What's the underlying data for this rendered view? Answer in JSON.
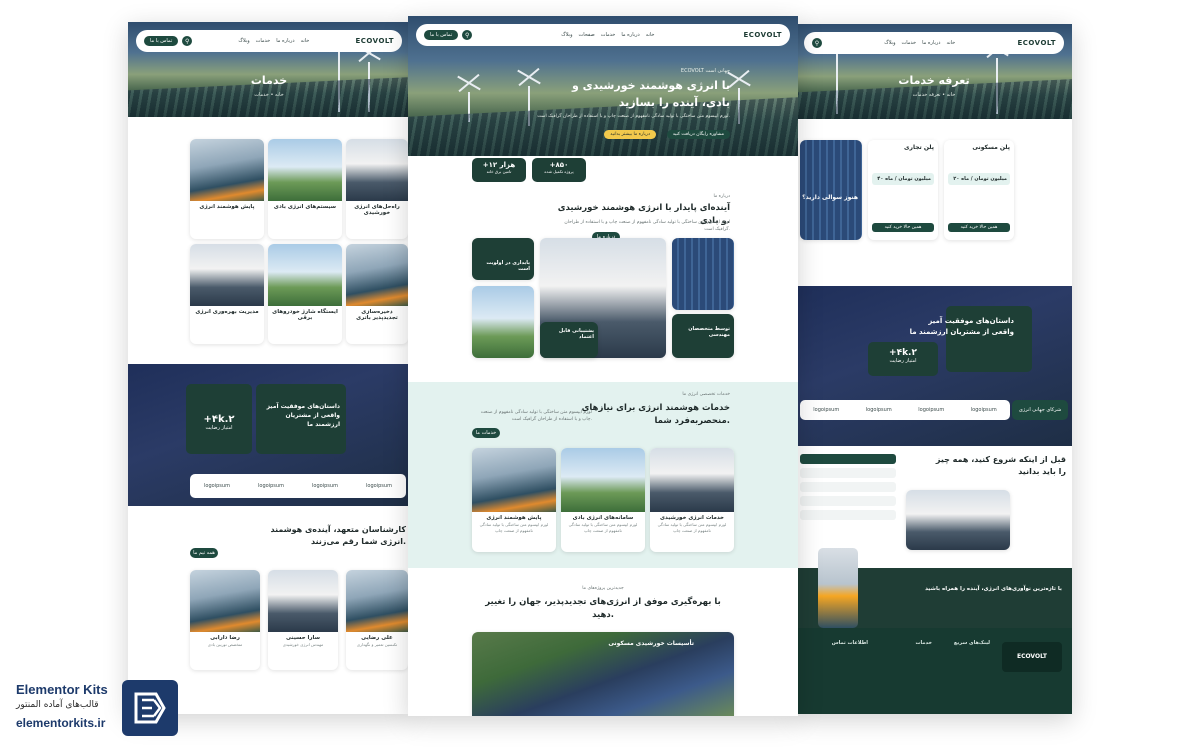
{
  "brand": {
    "name": "Elementor Kits",
    "subtitle": "قالب‌های آماده المنتور",
    "url": "elementorkits.ir",
    "logo_icon": "ek-monogram-icon",
    "color": "#1d3a6b"
  },
  "site": {
    "logo": "ECOVOLT",
    "accent": "#1e4a3f"
  },
  "left_page": {
    "nav_links": [
      "خانه",
      "درباره ما",
      "خدمات",
      "وبلاگ"
    ],
    "nav_cta": "تماس با ما",
    "hero_title": "خدمات",
    "breadcrumb": "خانه  •  خدمات",
    "services": [
      {
        "title": "پایش هوشمند انرژی"
      },
      {
        "title": "سیستم‌های انرژی بادی"
      },
      {
        "title": "راه‌حل‌های انرژی خورشیدی"
      },
      {
        "title": "مدیریت بهره‌وری انرژی"
      },
      {
        "title": "ایستگاه شارژ خودروهای برقی"
      },
      {
        "title": "ذخیره‌سازی تجدیدپذیر باتری"
      }
    ],
    "testimonial_title": "داستان‌های موفقیت آمیز\nواقعی از مشتریان ارزشمند ما",
    "stat_value": "+۴k.۲",
    "stat_label": "امتیاز رضایت",
    "team_title": "کارشناسان متعهد، آینده‌ی هوشمند\nانرژی شما رقم می‌زنند.",
    "team_button": "همه تیم ما",
    "team": [
      {
        "name": "رضا دارابی",
        "role": "متخصص توربین بادی"
      },
      {
        "name": "سارا حسینی",
        "role": "مهندس انرژی خورشیدی"
      },
      {
        "name": "علی رضایی",
        "role": "تکنسین تعمیر و نگهداری"
      }
    ],
    "logos": [
      "logoipsum",
      "logoipsum",
      "logoipsum",
      "logoipsum"
    ]
  },
  "center_page": {
    "nav_links": [
      "خانه",
      "درباره ما",
      "خدمات",
      "صفحات",
      "وبلاگ"
    ],
    "nav_cta": "تماس با ما",
    "hero_eyebrow": "ECOVOLT جهانی است",
    "hero_title": "با انرژی هوشمند خورشیدی و\nبادی، آینده را بسازید",
    "hero_text": "لورم ایپسوم متن ساختگی با تولید سادگی نامفهوم از صنعت چاپ و با استفاده از طراحان گرافیک است.",
    "hero_btn_primary": "مشاوره رایگان دریافت کنید",
    "hero_btn_secondary": "درباره ما بیشتر بدانید",
    "stats": [
      {
        "value": "+۸۵۰",
        "label": "پروژه تکمیل شده"
      },
      {
        "value": "+۱۲ هزار",
        "label": "تامین برق خانه"
      }
    ],
    "about_eyebrow": "درباره ما",
    "about_title": "آینده‌ای پایدار با انرژی هوشمند خورشیدی\nو بادی.",
    "about_text": "لورم ایپسوم متن ساختگی با تولید سادگی نامفهوم از صنعت چاپ و با استفاده از طراحان گرافیک است.",
    "about_button": "درباره ما",
    "features": [
      {
        "title": "پایداری در اولویت است"
      },
      {
        "title": "پشتیبانی قابل اعتماد"
      },
      {
        "title": "توسط متخصصان مهندسی"
      }
    ],
    "services_eyebrow": "خدمات تخصصی انرژی ما",
    "services_title": "خدمات هوشمند انرژی برای نیازهای\nمنحصربه‌فرد شما.",
    "services_text": "لورم ایپسوم متن ساختگی با تولید سادگی نامفهوم از صنعت چاپ و با استفاده از طراحان گرافیک است.",
    "services_button": "خدمات ما",
    "services": [
      {
        "title": "پایش هوشمند انرژی",
        "desc": "لورم ایپسوم متن ساختگی با تولید سادگی نامفهوم از صنعت چاپ"
      },
      {
        "title": "سامانه‌های انرژی بادی",
        "desc": "لورم ایپسوم متن ساختگی با تولید سادگی نامفهوم از صنعت چاپ"
      },
      {
        "title": "خدمات انرژی خورشیدی",
        "desc": "لورم ایپسوم متن ساختگی با تولید سادگی نامفهوم از صنعت چاپ"
      }
    ],
    "projects_eyebrow": "جدیدترین پروژه‌های ما",
    "projects_title": "با بهره‌گیری موفق از انرژی‌های تجدیدپذیر، جهان را تغییر\nدهید.",
    "project_card": "تأسیسات خورشیدی مسکونی"
  },
  "right_page": {
    "nav_links": [
      "خانه",
      "درباره ما",
      "خدمات",
      "وبلاگ"
    ],
    "hero_title": "تعرفه خدمات",
    "breadcrumb": "خانه  •  تعرفه خدمات",
    "plans": [
      {
        "name": "پلن مسکونی",
        "price": "۲۰ میلیون تومان / ماه",
        "button": "همین حالا خرید کنید"
      },
      {
        "name": "پلن تجاری",
        "price": "۴۰ میلیون تومان / ماه",
        "button": "همین حالا خرید کنید"
      }
    ],
    "promo_title": "هنوز سوالی دارید؟",
    "testimonial_title": "داستان‌های موفقیت آمیز\nواقعی از مشتریان ارزشمند ما",
    "stat_value": "+۴k.۲",
    "stat_label": "امتیاز رضایت",
    "partners_label": "شرکای جهانی انرژی",
    "logos": [
      "logoipsum",
      "logoipsum",
      "logoipsum",
      "logoipsum"
    ],
    "faq_title": "قبل از اینکه شروع کنید، همه چیز\nرا باید بدانید",
    "cta_title": "با تازه‌ترین نوآوری‌های انرژی، آینده را همراه باشید",
    "footer_logo": "ECOVOLT",
    "footer_cols": [
      "لینک‌های سریع",
      "خدمات",
      "اطلاعات تماس"
    ]
  }
}
